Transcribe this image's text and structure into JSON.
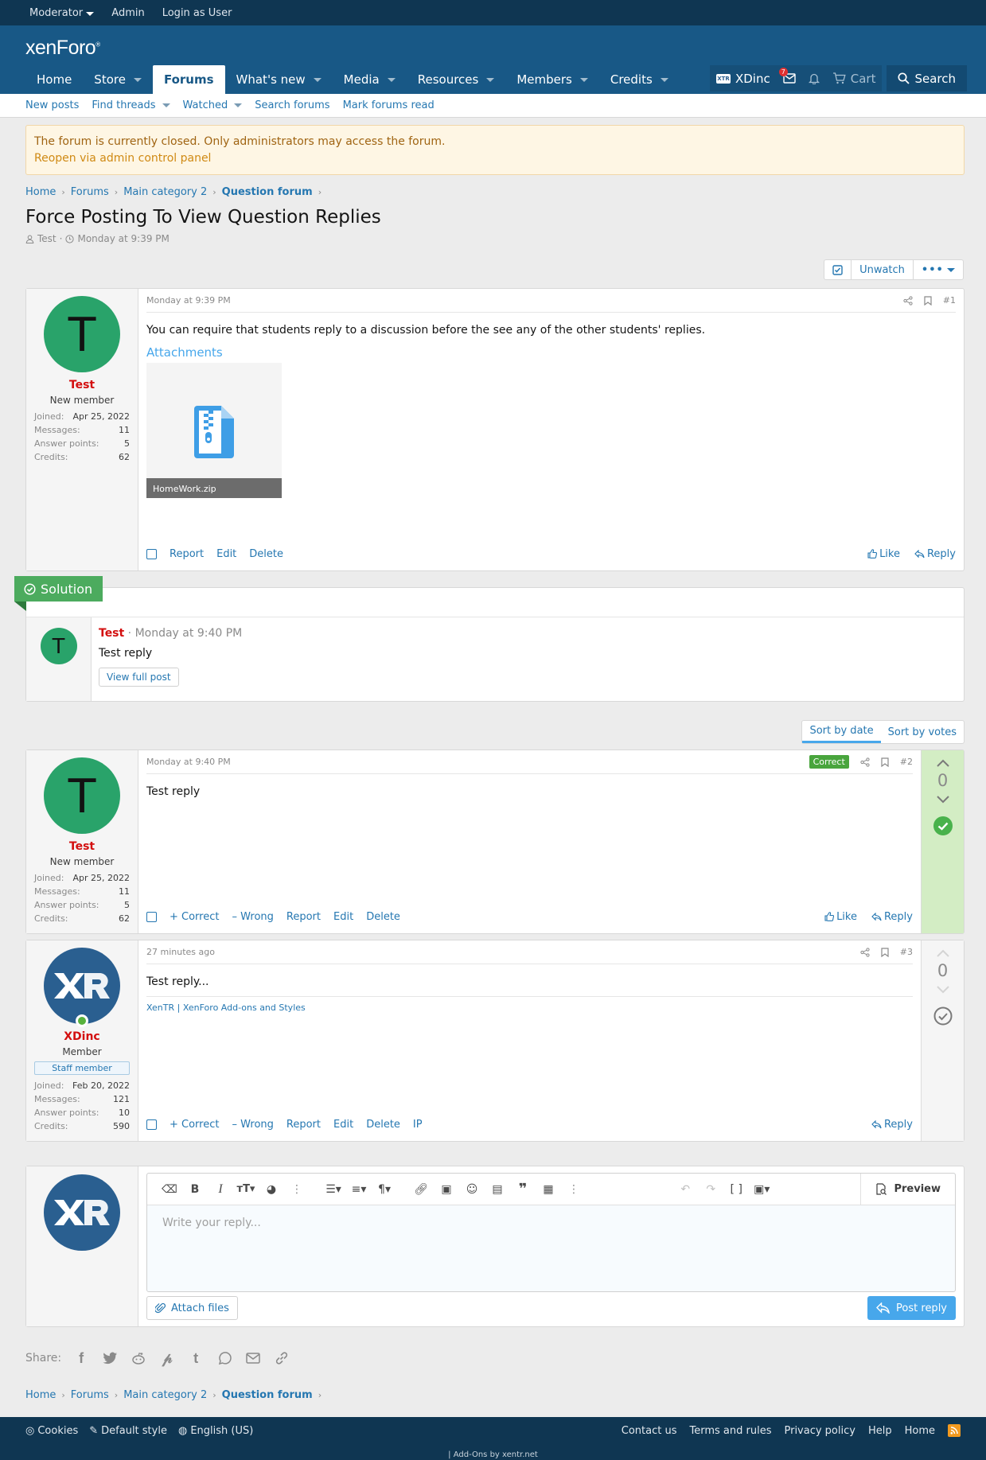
{
  "adminbar": {
    "moderator": "Moderator",
    "admin": "Admin",
    "login_as_user": "Login as User"
  },
  "header": {
    "logo": "xenForo",
    "logo_mark": "®"
  },
  "nav": {
    "tabs": [
      {
        "label": "Home",
        "caret": false,
        "active": false
      },
      {
        "label": "Store",
        "caret": true,
        "active": false
      },
      {
        "label": "Forums",
        "caret": false,
        "active": true
      },
      {
        "label": "What's new",
        "caret": true,
        "active": false
      },
      {
        "label": "Media",
        "caret": true,
        "active": false
      },
      {
        "label": "Resources",
        "caret": true,
        "active": false
      },
      {
        "label": "Members",
        "caret": true,
        "active": false
      },
      {
        "label": "Credits",
        "caret": true,
        "active": false
      }
    ],
    "user": "XDinc",
    "inbox_count": "7",
    "cart": "Cart",
    "search": "Search"
  },
  "subnav": {
    "new_posts": "New posts",
    "find_threads": "Find threads",
    "watched": "Watched",
    "search_forums": "Search forums",
    "mark_read": "Mark forums read"
  },
  "notice": {
    "text": "The forum is currently closed. Only administrators may access the forum.",
    "link": "Reopen via admin control panel"
  },
  "breadcrumb": {
    "home": "Home",
    "forums": "Forums",
    "category": "Main category 2",
    "current": "Question forum"
  },
  "thread": {
    "title": "Force Posting To View Question Replies",
    "author": "Test",
    "date": "Monday at 9:39 PM",
    "unwatch": "Unwatch"
  },
  "post1": {
    "date": "Monday at 9:39 PM",
    "num": "#1",
    "text": "You can require that students reply to a discussion before the see any of the other students' replies.",
    "attachments_label": "Attachments",
    "file": "HomeWork.zip",
    "user": {
      "initial": "T",
      "name": "Test",
      "title": "New member",
      "joined_label": "Joined:",
      "joined": "Apr 25, 2022",
      "messages_label": "Messages:",
      "messages": "11",
      "answer_label": "Answer points:",
      "answer": "5",
      "credits_label": "Credits:",
      "credits": "62"
    },
    "report": "Report",
    "edit": "Edit",
    "delete": "Delete",
    "like": "Like",
    "reply": "Reply"
  },
  "solution": {
    "banner": "Solution",
    "initial": "T",
    "user": "Test",
    "date": "Monday at 9:40 PM",
    "text": "Test reply",
    "view": "View full post"
  },
  "sort": {
    "by_date": "Sort by date",
    "by_votes": "Sort by votes"
  },
  "post2": {
    "date": "Monday at 9:40 PM",
    "num": "#2",
    "badge": "Correct",
    "text": "Test reply",
    "score": "0",
    "user": {
      "initial": "T",
      "name": "Test",
      "title": "New member",
      "joined_label": "Joined:",
      "joined": "Apr 25, 2022",
      "messages_label": "Messages:",
      "messages": "11",
      "answer_label": "Answer points:",
      "answer": "5",
      "credits_label": "Credits:",
      "credits": "62"
    },
    "correct": "Correct",
    "wrong": "Wrong",
    "report": "Report",
    "edit": "Edit",
    "delete": "Delete",
    "like": "Like",
    "reply": "Reply"
  },
  "post3": {
    "date": "27 minutes ago",
    "num": "#3",
    "text": "Test reply...",
    "signature": "XenTR | XenForo Add-ons and Styles",
    "score": "0",
    "user": {
      "name": "XDinc",
      "title": "Member",
      "banner": "Staff member",
      "joined_label": "Joined:",
      "joined": "Feb 20, 2022",
      "messages_label": "Messages:",
      "messages": "121",
      "answer_label": "Answer points:",
      "answer": "10",
      "credits_label": "Credits:",
      "credits": "590"
    },
    "correct": "Correct",
    "wrong": "Wrong",
    "report": "Report",
    "edit": "Edit",
    "delete": "Delete",
    "ip": "IP",
    "reply": "Reply"
  },
  "editor": {
    "placeholder": "Write your reply...",
    "preview": "Preview",
    "attach": "Attach files",
    "post": "Post reply"
  },
  "share": {
    "label": "Share:"
  },
  "footer": {
    "cookies": "Cookies",
    "style": "Default style",
    "language": "English (US)",
    "contact": "Contact us",
    "terms": "Terms and rules",
    "privacy": "Privacy policy",
    "help": "Help",
    "home": "Home",
    "addons": "| Add-Ons by xentr.net"
  },
  "colors": {
    "brand": "#185886",
    "dark": "#0f3652",
    "link": "#2577b1",
    "username": "#d30f0f",
    "solution": "#4cab5e",
    "accent": "#47a7eb"
  }
}
